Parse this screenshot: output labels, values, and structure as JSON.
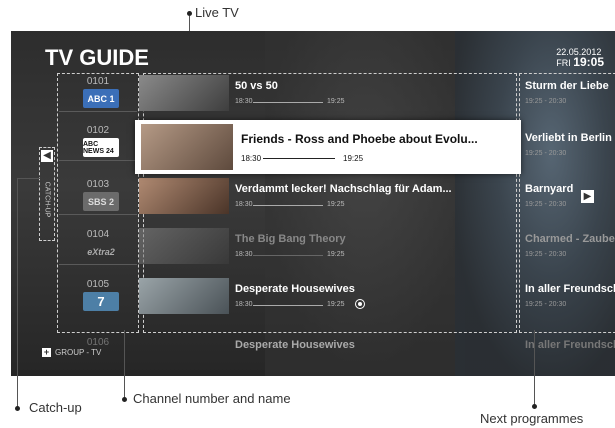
{
  "callouts": {
    "live_tv": "Live TV",
    "catch_up": "Catch-up",
    "channel": "Channel number and name",
    "next": "Next programmes"
  },
  "guide": {
    "title": "TV GUIDE",
    "date": "22.05.2012",
    "day": "FRI",
    "time": "19:05",
    "catchup_label": "CATCH-UP",
    "group_label": "GROUP - TV"
  },
  "channels": [
    {
      "number": "0101",
      "logo": "ABC 1",
      "color": "#3b6fb8"
    },
    {
      "number": "0102",
      "logo": "ABC NEWS 24",
      "color": "#ffffff"
    },
    {
      "number": "0103",
      "logo": "SBS 2",
      "color": "#999999"
    },
    {
      "number": "0104",
      "logo": "eXtra2",
      "color": "#9a9a9a"
    },
    {
      "number": "0105",
      "logo": "7",
      "color": "#6aa0c8"
    },
    {
      "number": "0106",
      "logo": "",
      "color": "#666666"
    }
  ],
  "programmes": [
    {
      "title": "50 vs 50",
      "start": "18:30",
      "end": "19:25"
    },
    {
      "title": "Friends - Ross and Phoebe about Evolu...",
      "start": "18:30",
      "end": "19:25"
    },
    {
      "title": "Verdammt lecker! Nachschlag für Adam...",
      "start": "18:30",
      "end": "19:25"
    },
    {
      "title": "The Big Bang Theory",
      "start": "18:30",
      "end": "19:25"
    },
    {
      "title": "Desperate Housewives",
      "start": "18:30",
      "end": "19:25"
    },
    {
      "title": "Desperate Housewives",
      "start": "",
      "end": ""
    }
  ],
  "next": [
    {
      "title": "Sturm der Liebe",
      "time": "19:25 - 20:30"
    },
    {
      "title": "Verliebt in Berlin",
      "time": "19:25 - 20:30"
    },
    {
      "title": "Barnyard",
      "time": "19:25 - 20:30"
    },
    {
      "title": "Charmed - Zauberhafte",
      "time": "19:25 - 20:30"
    },
    {
      "title": "In aller Freundschaft",
      "time": "19:25 - 20:30"
    },
    {
      "title": "In aller Freundschaft",
      "time": ""
    }
  ]
}
